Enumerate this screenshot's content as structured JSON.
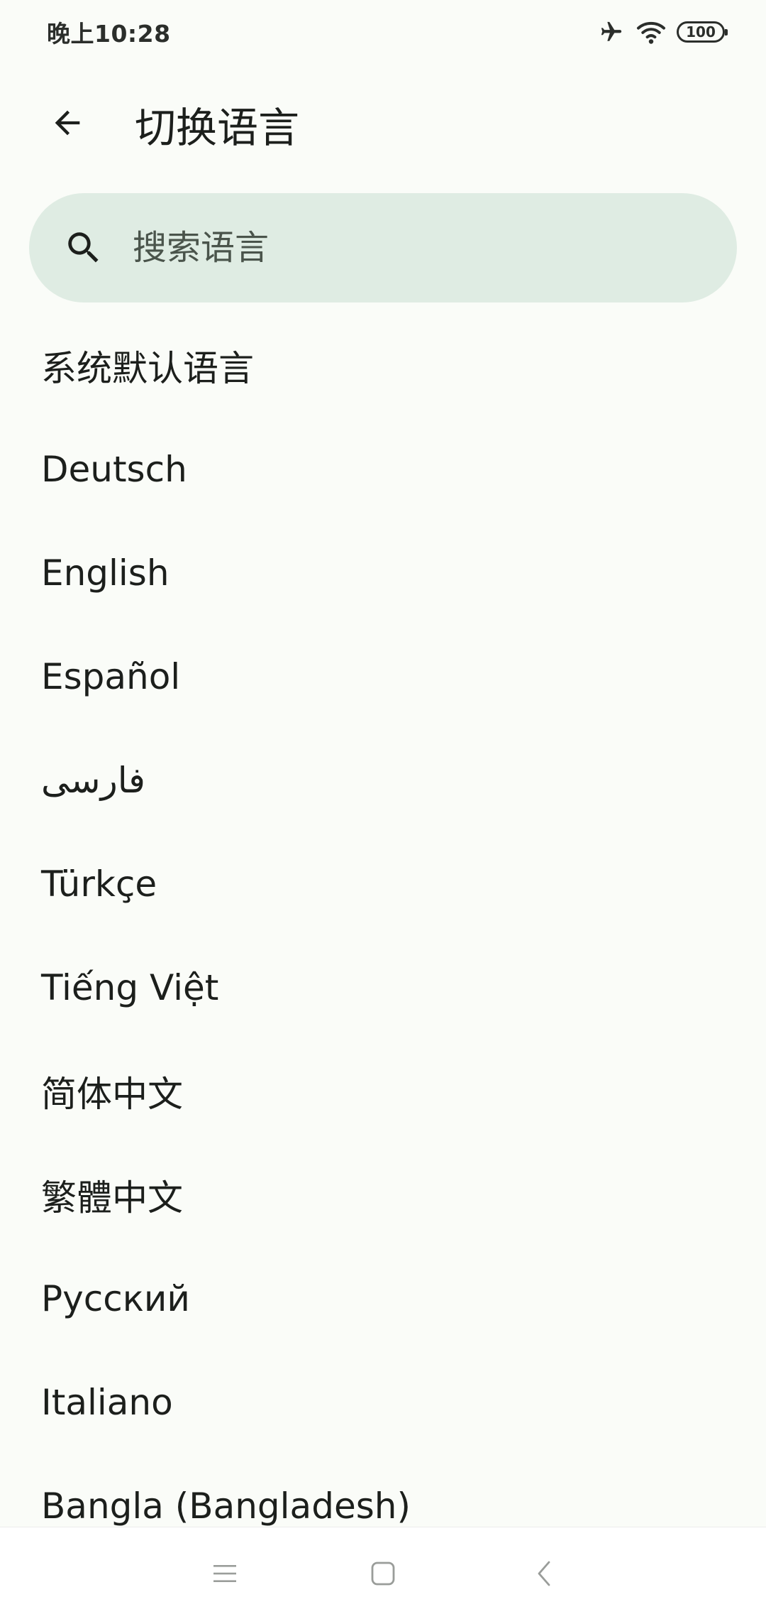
{
  "status_bar": {
    "time": "晚上10:28",
    "battery": "100",
    "icons": [
      "airplane-icon",
      "wifi-icon",
      "battery-icon"
    ]
  },
  "app_bar": {
    "back_icon": "arrow-left-icon",
    "title": "切换语言"
  },
  "search": {
    "icon": "search-icon",
    "placeholder": "搜索语言",
    "value": ""
  },
  "languages": [
    "系统默认语言",
    "Deutsch",
    "English",
    "Español",
    "فارسی",
    "Türkçe",
    "Tiếng Việt",
    "简体中文",
    "繁體中文",
    "Русский",
    "Italiano",
    "Bangla (Bangladesh)"
  ],
  "nav_bar": {
    "buttons": [
      "menu-icon",
      "home-icon",
      "back-chevron-icon"
    ]
  },
  "colors": {
    "background": "#fafcf8",
    "search_background": "#dfece3",
    "text_primary": "#1c1f1c"
  }
}
